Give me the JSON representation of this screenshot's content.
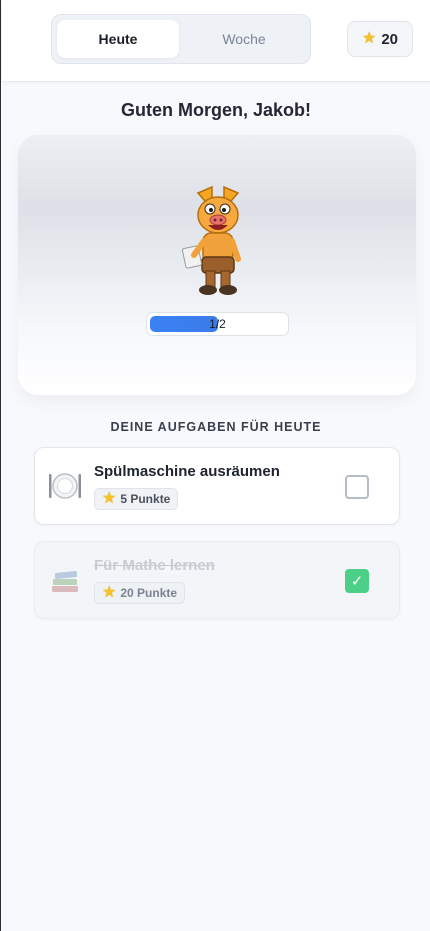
{
  "header": {
    "tabs": [
      {
        "label": "Heute",
        "active": true
      },
      {
        "label": "Woche",
        "active": false
      }
    ],
    "points": "20"
  },
  "greeting": "Guten Morgen, Jakob!",
  "progress": {
    "label": "1/2",
    "fraction": 0.5
  },
  "section_title": "DEINE AUFGABEN FÜR HEUTE",
  "tasks": [
    {
      "title": "Spülmaschine ausräumen",
      "points": "5 Punkte",
      "icon": "plate-cutlery-icon",
      "done": false
    },
    {
      "title": "Für Mathe lernen",
      "points": "20 Punkte",
      "icon": "books-icon",
      "done": true
    }
  ],
  "colors": {
    "accent": "#3b82f6",
    "check": "#4ccf86",
    "star": "#f5c22a"
  }
}
